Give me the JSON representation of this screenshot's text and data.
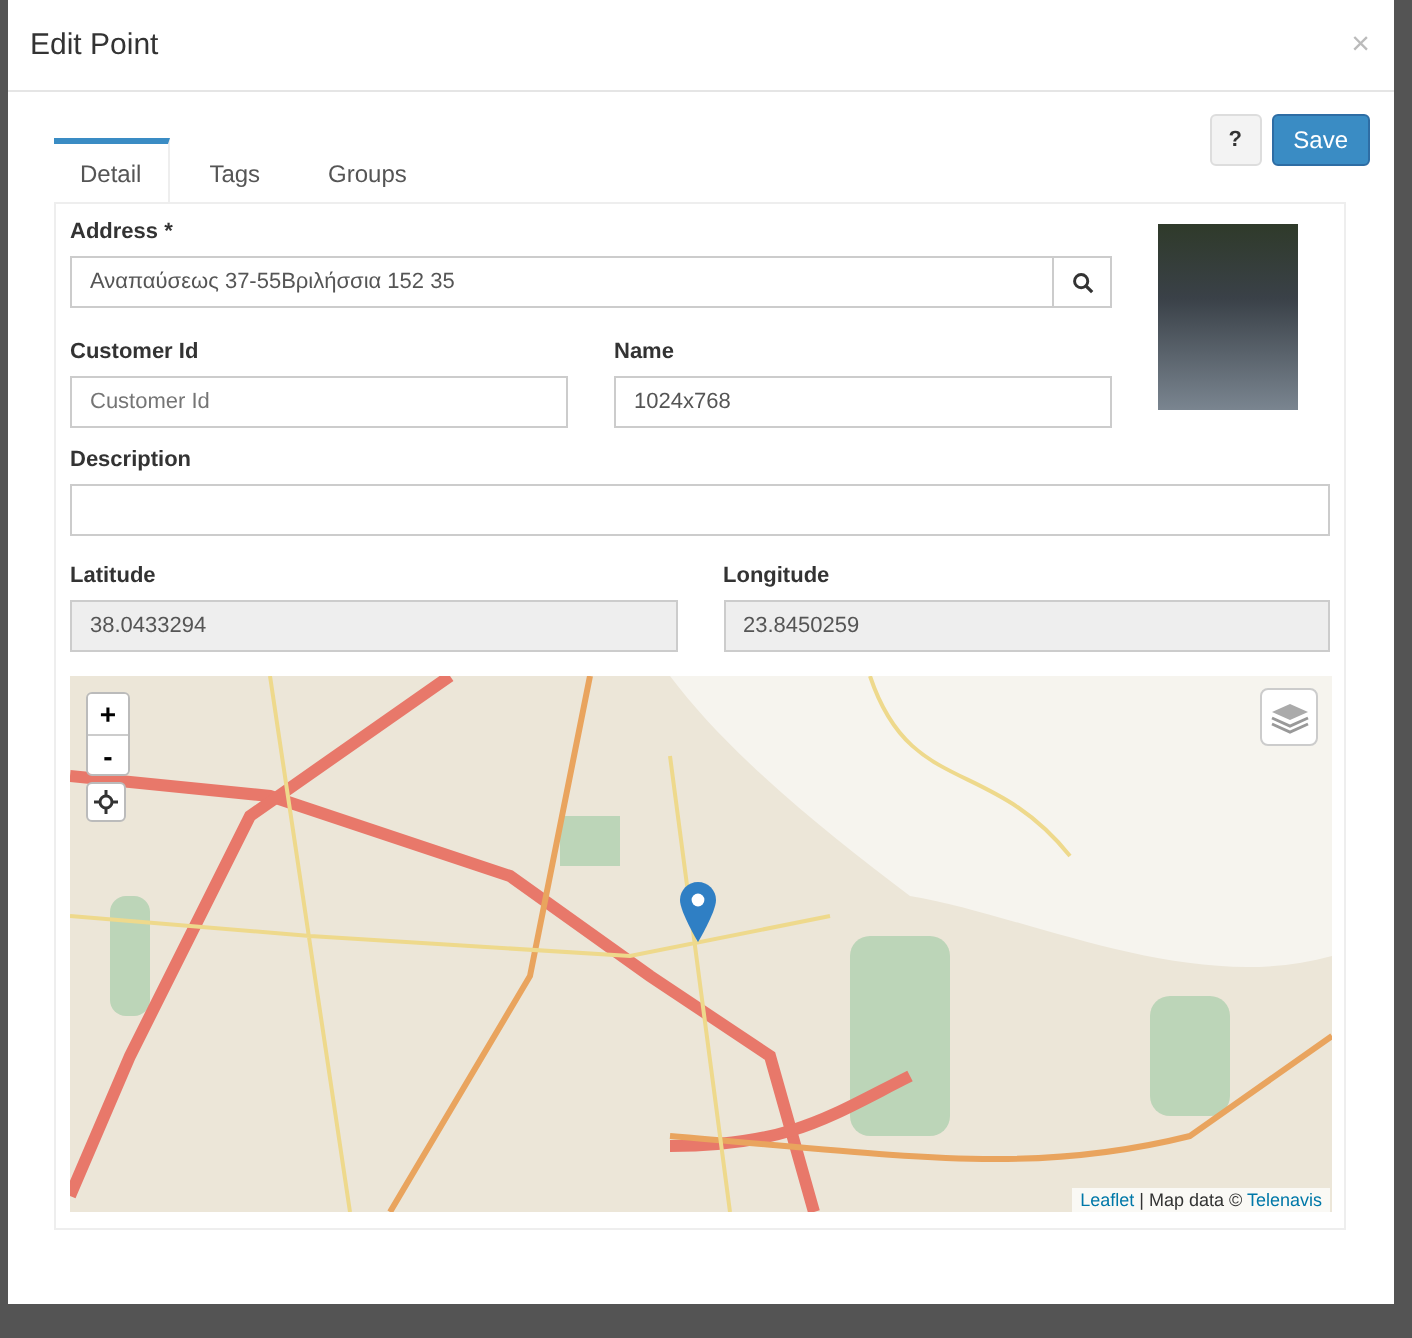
{
  "dialog": {
    "title": "Edit Point",
    "close": "×"
  },
  "toolbar": {
    "help": "?",
    "save": "Save"
  },
  "tabs": [
    {
      "label": "Detail",
      "selected": true
    },
    {
      "label": "Tags",
      "selected": false
    },
    {
      "label": "Groups",
      "selected": false
    }
  ],
  "address": {
    "label": "Address *",
    "value": "Αναπαύσεως 37-55Βριλήσσια 152 35"
  },
  "customer_id": {
    "label": "Customer Id",
    "placeholder": "Customer Id"
  },
  "name": {
    "label": "Name",
    "value": "1024x768"
  },
  "description": {
    "label": "Description"
  },
  "latitude": {
    "label": "Latitude",
    "value": "38.0433294",
    "disabled": true
  },
  "longitude": {
    "label": "Longitude",
    "value": "23.8450259",
    "disabled": true
  },
  "map": {
    "zoom_in": "+",
    "zoom_out": "-",
    "attribution_link": "Leaflet",
    "attribution_text": " | Map data © ",
    "provider_link": "Telenavis"
  }
}
